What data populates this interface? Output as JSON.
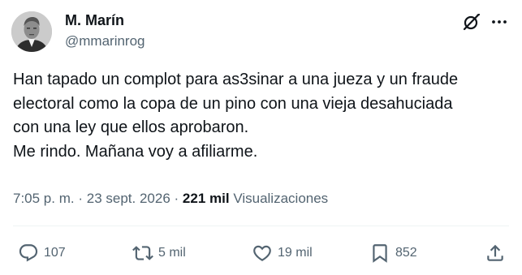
{
  "author": {
    "name": "M. Marín",
    "handle": "@mmarinrog"
  },
  "tweet": {
    "lines": [
      "Han tapado un complot para as3sinar a una jueza y un fraude",
      "electoral como la copa de un pino con una vieja desahuciada",
      "con una ley que ellos aprobaron.",
      "Me rindo. Mañana voy a afiliarme."
    ]
  },
  "meta": {
    "time": "7:05 p. m.",
    "separator": "·",
    "date": "23 sept. 2026",
    "views_count": "221 mil",
    "views_label": "Visualizaciones"
  },
  "actions": {
    "replies": "107",
    "reposts": "5 mil",
    "likes": "19 mil",
    "bookmarks": "852"
  },
  "icons": {
    "top_right": [
      "grok-icon",
      "more-icon"
    ],
    "actions": [
      "reply-icon",
      "repost-icon",
      "like-icon",
      "bookmark-icon",
      "share-icon"
    ]
  },
  "colors": {
    "text": "#0f1419",
    "secondary": "#536471",
    "divider": "#eff3f4"
  }
}
